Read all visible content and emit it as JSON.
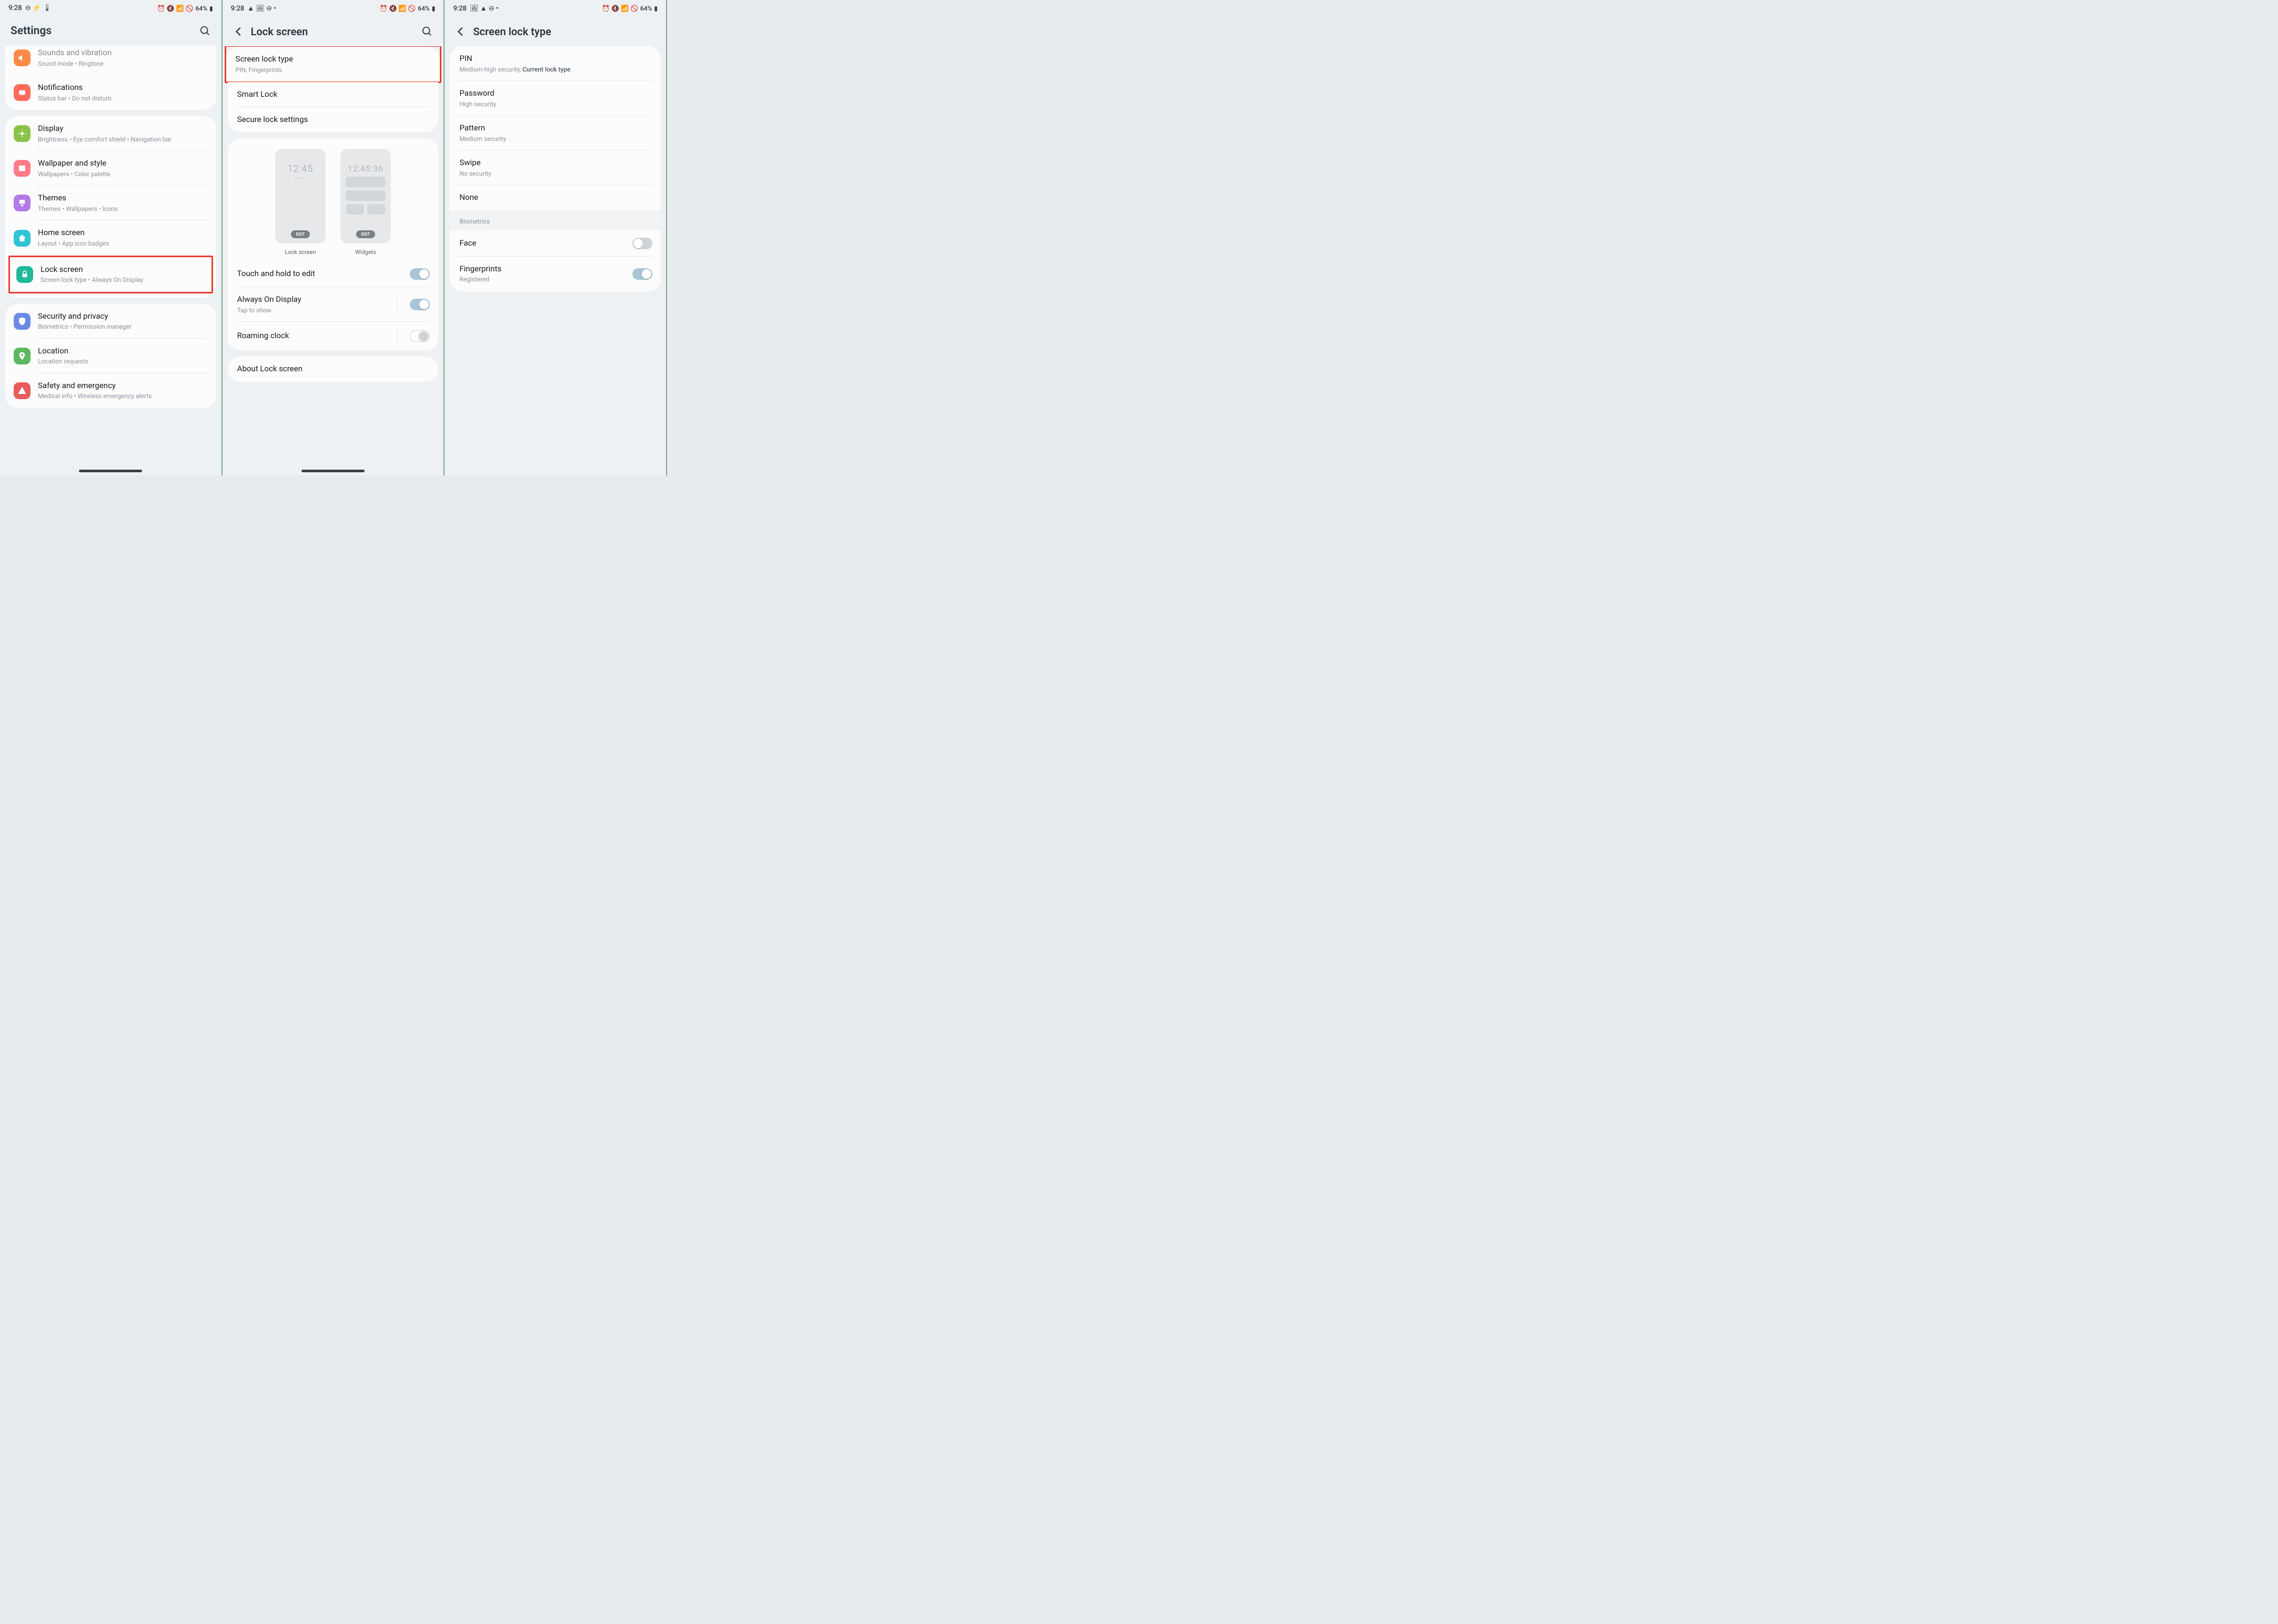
{
  "status": {
    "time": "9:28",
    "battery": "64%",
    "icons_left_1": "⊖ ⚡ 🌡",
    "icons_left_2": "▲ 🖼 ⊖ •",
    "icons_left_3": "🖼 ▲ ⊖ •",
    "icons_right": "⏰ 🔇 📶 🚫"
  },
  "screen1": {
    "title": "Settings",
    "items": [
      {
        "title": "Sounds and vibration",
        "sub": "Sound mode • Ringtone",
        "color": "#ff8a47"
      },
      {
        "title": "Notifications",
        "sub": "Status bar • Do not disturb",
        "color": "#ff6b5b"
      },
      {
        "title": "Display",
        "sub": "Brightness • Eye comfort shield • Navigation bar",
        "color": "#8bc34a"
      },
      {
        "title": "Wallpaper and style",
        "sub": "Wallpapers • Color palette",
        "color": "#ff7b8a"
      },
      {
        "title": "Themes",
        "sub": "Themes • Wallpapers • Icons",
        "color": "#b47ae8"
      },
      {
        "title": "Home screen",
        "sub": "Layout • App icon badges",
        "color": "#2fc4d6"
      },
      {
        "title": "Lock screen",
        "sub": "Screen lock type • Always On Display",
        "color": "#1fb89a"
      },
      {
        "title": "Security and privacy",
        "sub": "Biometrics • Permission manager",
        "color": "#6b8ae8"
      },
      {
        "title": "Location",
        "sub": "Location requests",
        "color": "#5cb860"
      },
      {
        "title": "Safety and emergency",
        "sub": "Medical info • Wireless emergency alerts",
        "color": "#e85c5c"
      }
    ]
  },
  "screen2": {
    "title": "Lock screen",
    "group1": [
      {
        "title": "Screen lock type",
        "sub": "PIN, Fingerprints"
      },
      {
        "title": "Smart Lock"
      },
      {
        "title": "Secure lock settings"
      }
    ],
    "preview": {
      "lock_time": "12:45",
      "widget_time": "12:45:36",
      "edit": "EDIT",
      "lock_label": "Lock screen",
      "widget_label": "Widgets"
    },
    "toggles": [
      {
        "title": "Touch and hold to edit"
      },
      {
        "title": "Always On Display",
        "sub": "Tap to show"
      },
      {
        "title": "Roaming clock"
      }
    ],
    "about": "About Lock screen"
  },
  "screen3": {
    "title": "Screen lock type",
    "types": [
      {
        "title": "PIN",
        "sub": "Medium-high security, ",
        "extra": "Current lock type"
      },
      {
        "title": "Password",
        "sub": "High security"
      },
      {
        "title": "Pattern",
        "sub": "Medium security"
      },
      {
        "title": "Swipe",
        "sub": "No security"
      },
      {
        "title": "None"
      }
    ],
    "bio_label": "Biometrics",
    "bio": [
      {
        "title": "Face",
        "on": false
      },
      {
        "title": "Fingerprints",
        "sub": "Registered",
        "on": true
      }
    ]
  }
}
